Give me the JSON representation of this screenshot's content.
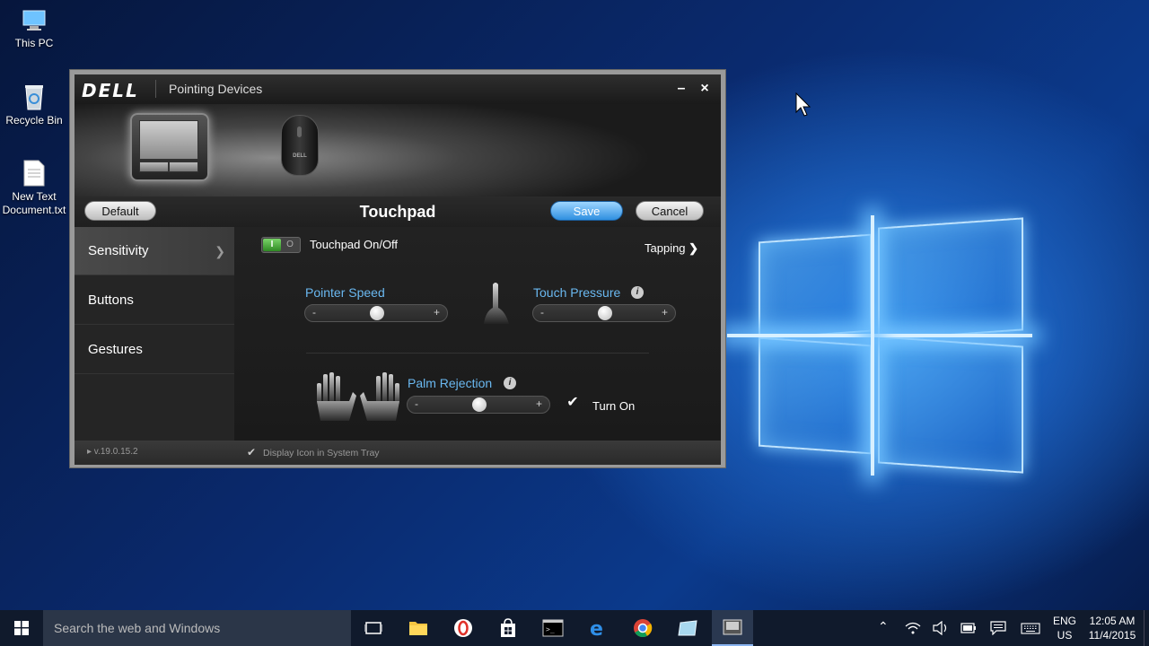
{
  "desktop": {
    "icons": [
      {
        "label": "This PC"
      },
      {
        "label": "Recycle Bin"
      },
      {
        "label": "New Text Document.txt"
      }
    ]
  },
  "window": {
    "brand": "DELL",
    "title": "Pointing Devices",
    "minimize": "–",
    "close": "×",
    "devices": [
      "touchpad-device",
      "mouse-device"
    ],
    "mouse_logo": "DELL",
    "toolbar": {
      "default_label": "Default",
      "page_title": "Touchpad",
      "save_label": "Save",
      "cancel_label": "Cancel"
    },
    "sidebar": {
      "items": [
        {
          "label": "Sensitivity",
          "active": true
        },
        {
          "label": "Buttons"
        },
        {
          "label": "Gestures"
        }
      ]
    },
    "content": {
      "toggle_on": "I",
      "toggle_off": "O",
      "touchpad_onoff_label": "Touchpad On/Off",
      "tapping_label": "Tapping",
      "pointer_speed": {
        "label": "Pointer Speed",
        "min": "-",
        "max": "+",
        "value": 0.5
      },
      "touch_pressure": {
        "label": "Touch Pressure",
        "min": "-",
        "max": "+",
        "value": 0.5
      },
      "palm_rejection": {
        "label": "Palm Rejection",
        "min": "-",
        "max": "+",
        "value": 0.5
      },
      "palm_turn_on_label": "Turn On",
      "info_glyph": "i"
    },
    "footer": {
      "version": "▸ v.19.0.15.2",
      "tray_label": "Display Icon in System Tray"
    }
  },
  "taskbar": {
    "search_placeholder": "Search the web and Windows",
    "lang_line1": "ENG",
    "lang_line2": "US",
    "time": "12:05 AM",
    "date": "11/4/2015"
  }
}
